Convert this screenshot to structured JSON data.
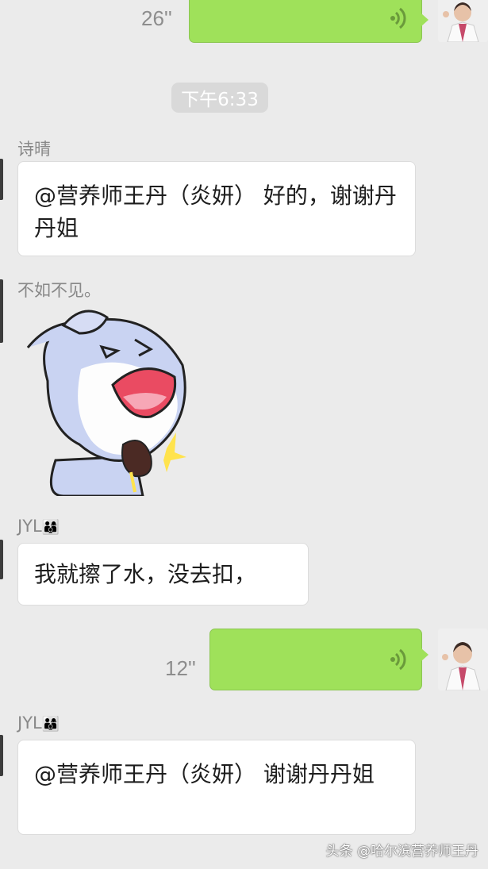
{
  "messages": [
    {
      "type": "voice",
      "side": "right",
      "duration": "26''"
    },
    {
      "type": "time",
      "label": "下午6:33"
    },
    {
      "type": "text",
      "sender": "诗晴",
      "text": "@营养师王丹（炎妍） 好的，谢谢丹丹姐"
    },
    {
      "type": "sticker",
      "sender": "不如不见。",
      "sticker": "laughing-clapping-cartoon"
    },
    {
      "type": "text",
      "sender": "JYL",
      "sender_emoji": "family-emoji",
      "text": "我就擦了水，没去扣，"
    },
    {
      "type": "voice",
      "side": "right",
      "duration": "12''"
    },
    {
      "type": "text",
      "sender": "JYL",
      "sender_emoji": "family-emoji",
      "text": "@营养师王丹（炎妍） 谢谢丹丹姐"
    }
  ],
  "watermark": "头条 @哈尔滨营养师王丹",
  "colors": {
    "voice_bubble": "#9fe15a",
    "text_bubble": "#ffffff",
    "background": "#ebebeb"
  }
}
